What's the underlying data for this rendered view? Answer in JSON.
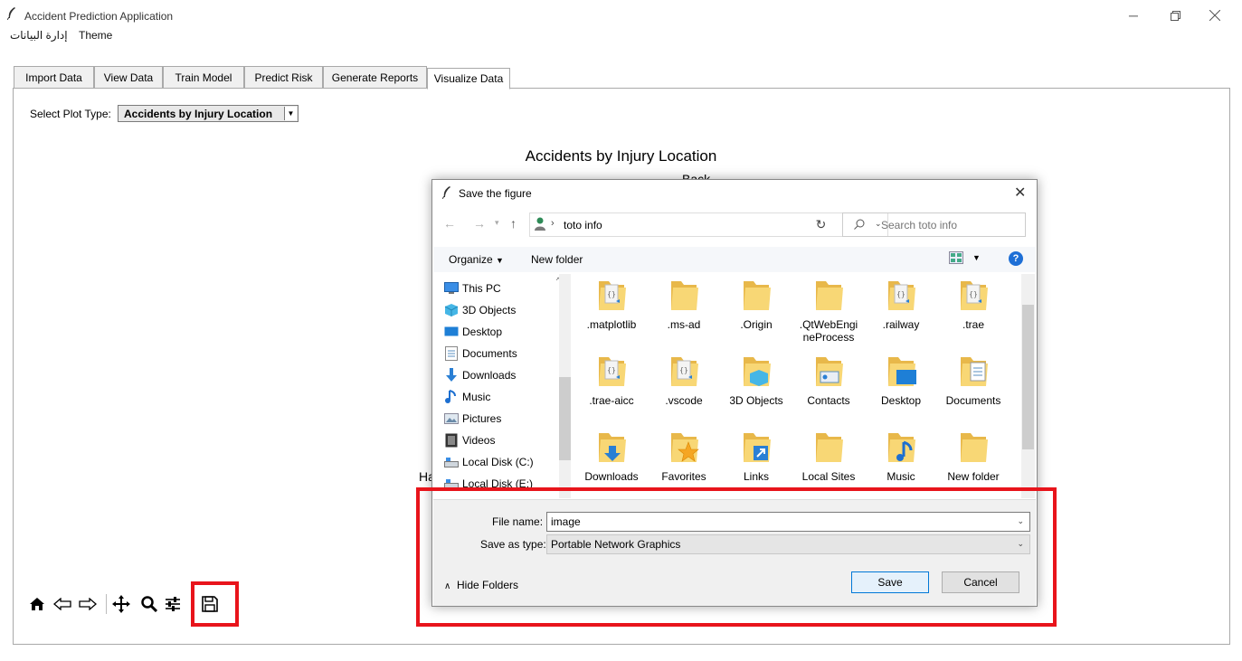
{
  "app": {
    "title": "Accident Prediction Application",
    "menu": [
      "إدارة البيانات",
      "Theme"
    ]
  },
  "tabs": [
    "Import Data",
    "View Data",
    "Train Model",
    "Predict Risk",
    "Generate Reports",
    "Visualize Data"
  ],
  "active_tab": "Visualize Data",
  "plot_selector": {
    "label": "Select Plot Type:",
    "value": "Accidents by Injury Location"
  },
  "chart": {
    "title": "Accidents by Injury Location",
    "partial_label_top": "Back",
    "partial_label_left": "Ha"
  },
  "toolbar_icons": [
    "home-icon",
    "back-arrow-icon",
    "forward-arrow-icon",
    "pan-icon",
    "zoom-icon",
    "configure-subplots-icon",
    "save-icon"
  ],
  "dialog": {
    "title": "Save the figure",
    "address_path": "toto info",
    "search_placeholder": "Search toto info",
    "organize_label": "Organize",
    "new_folder_label": "New folder",
    "nav_items": [
      {
        "label": "This PC",
        "icon": "computer-icon"
      },
      {
        "label": "3D Objects",
        "icon": "3d-objects-icon"
      },
      {
        "label": "Desktop",
        "icon": "desktop-icon"
      },
      {
        "label": "Documents",
        "icon": "documents-icon"
      },
      {
        "label": "Downloads",
        "icon": "downloads-icon"
      },
      {
        "label": "Music",
        "icon": "music-icon"
      },
      {
        "label": "Pictures",
        "icon": "pictures-icon"
      },
      {
        "label": "Videos",
        "icon": "videos-icon"
      },
      {
        "label": "Local Disk (C:)",
        "icon": "drive-icon"
      },
      {
        "label": "Local Disk (E:)",
        "icon": "drive-icon"
      }
    ],
    "files": [
      {
        "label": ".matplotlib",
        "icon": "folder-json-icon"
      },
      {
        "label": ".ms-ad",
        "icon": "folder-icon"
      },
      {
        "label": ".Origin",
        "icon": "folder-icon"
      },
      {
        "label": ".QtWebEngineProcess",
        "icon": "folder-icon"
      },
      {
        "label": ".railway",
        "icon": "folder-json-icon"
      },
      {
        "label": ".trae",
        "icon": "folder-json-icon"
      },
      {
        "label": ".trae-aicc",
        "icon": "folder-json-icon"
      },
      {
        "label": ".vscode",
        "icon": "folder-json-icon"
      },
      {
        "label": "3D Objects",
        "icon": "folder-3d-icon"
      },
      {
        "label": "Contacts",
        "icon": "folder-contacts-icon"
      },
      {
        "label": "Desktop",
        "icon": "folder-desktop-icon"
      },
      {
        "label": "Documents",
        "icon": "folder-documents-icon"
      },
      {
        "label": "Downloads",
        "icon": "folder-downloads-icon"
      },
      {
        "label": "Favorites",
        "icon": "folder-favorites-icon"
      },
      {
        "label": "Links",
        "icon": "folder-links-icon"
      },
      {
        "label": "Local Sites",
        "icon": "folder-icon"
      },
      {
        "label": "Music",
        "icon": "folder-music-icon"
      },
      {
        "label": "New folder",
        "icon": "folder-icon"
      }
    ],
    "file_name_label": "File name:",
    "file_name_value": "image",
    "save_type_label": "Save as type:",
    "save_type_value": "Portable Network Graphics",
    "hide_folders_label": "Hide Folders",
    "save_label": "Save",
    "cancel_label": "Cancel"
  },
  "colors": {
    "highlight_red": "#e8141b",
    "folder_yellow": "#f8d775",
    "accent_blue": "#0078d7"
  }
}
